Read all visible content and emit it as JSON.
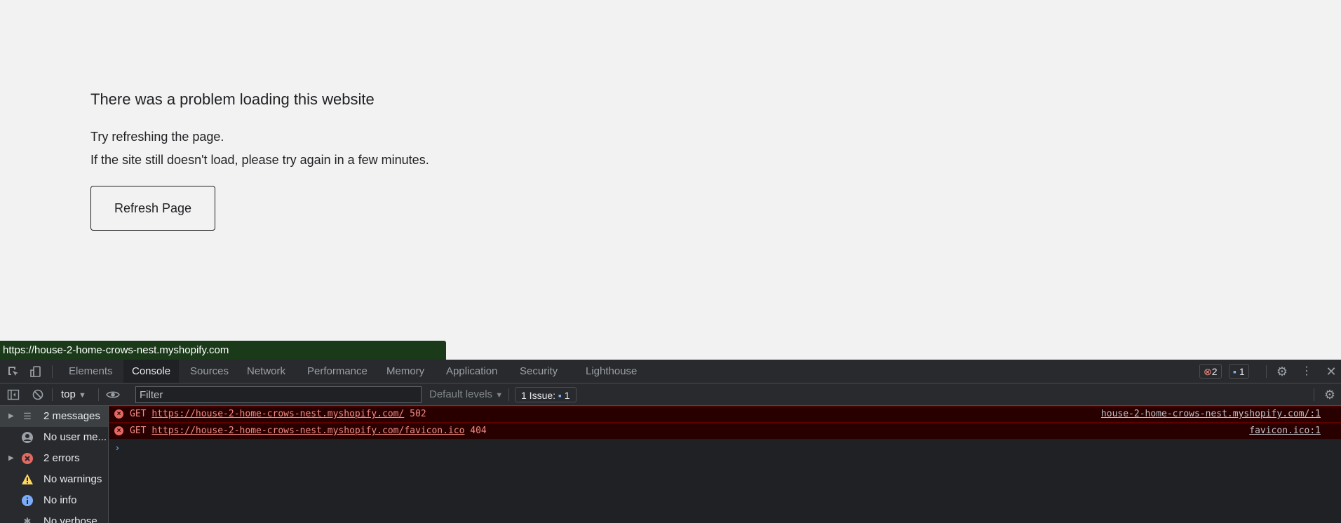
{
  "page": {
    "title": "There was a problem loading this website",
    "line1": "Try refreshing the page.",
    "line2": "If the site still doesn't load, please try again in a few minutes.",
    "refresh_label": "Refresh Page"
  },
  "status_url": "https://house-2-home-crows-nest.myshopify.com",
  "devtools": {
    "tabs": [
      "Elements",
      "Console",
      "Sources",
      "Network",
      "Performance",
      "Memory",
      "Application",
      "Security",
      "Lighthouse"
    ],
    "active_tab": "Console",
    "error_count": "2",
    "issue_count": "1",
    "context": "top",
    "filter_placeholder": "Filter",
    "levels": "Default levels",
    "issues_label": "1 Issue:",
    "issues_count": "1",
    "sidebar": [
      {
        "label": "2 messages",
        "icon": "list-icon"
      },
      {
        "label": "No user me...",
        "icon": "user-icon"
      },
      {
        "label": "2 errors",
        "icon": "error-icon"
      },
      {
        "label": "No warnings",
        "icon": "warning-icon"
      },
      {
        "label": "No info",
        "icon": "info-icon"
      },
      {
        "label": "No verbose",
        "icon": "bug-icon"
      }
    ],
    "messages": [
      {
        "method": "GET",
        "url": "https://house-2-home-crows-nest.myshopify.com/",
        "status": "502",
        "source": "house-2-home-crows-nest.myshopify.com/:1"
      },
      {
        "method": "GET",
        "url": "https://house-2-home-crows-nest.myshopify.com/favicon.ico",
        "status": "404",
        "source": "favicon.ico:1"
      }
    ]
  },
  "colors": {
    "error": "#f28b82",
    "error_bg": "#290000",
    "accent": "#7cacf8"
  }
}
